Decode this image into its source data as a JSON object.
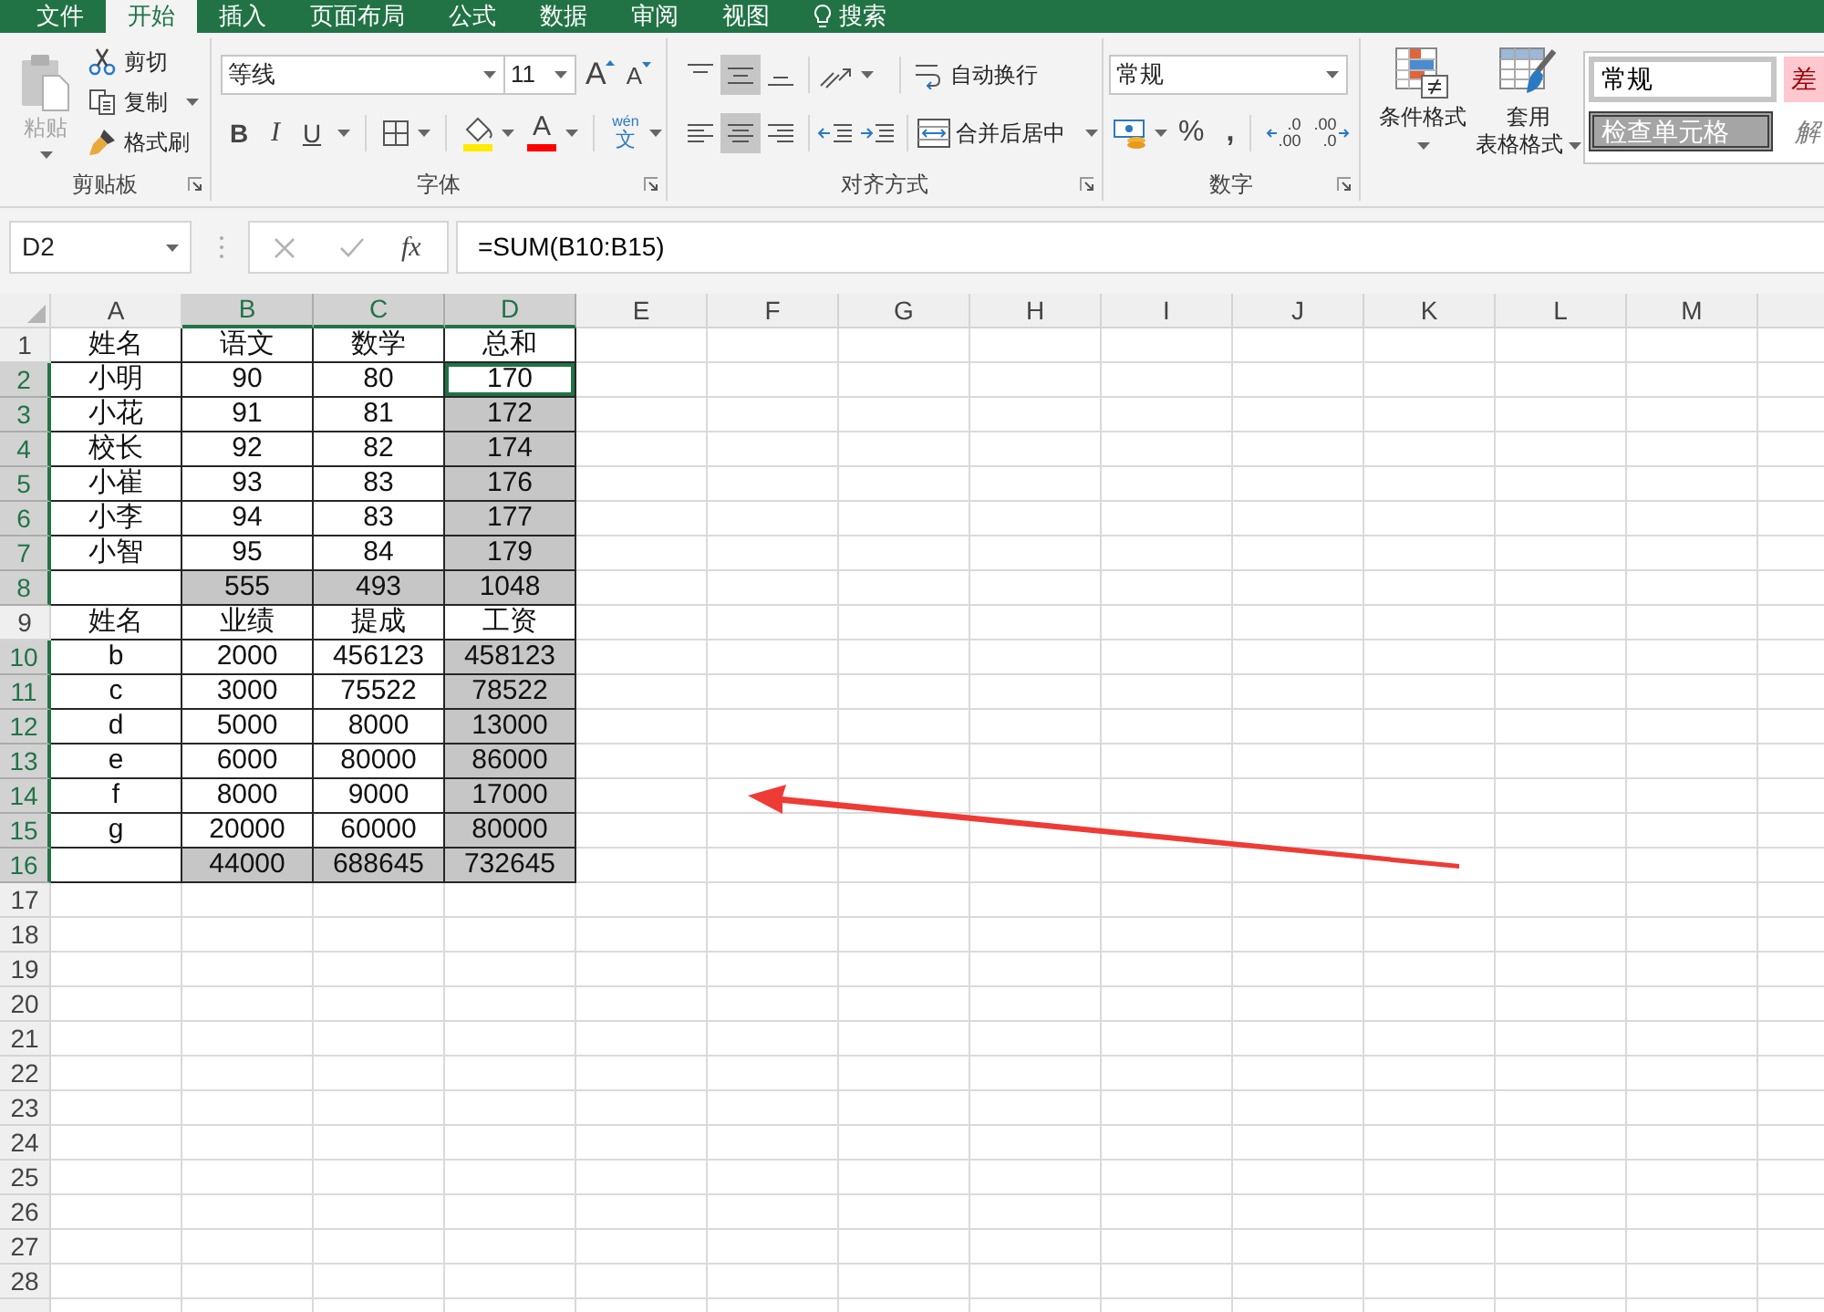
{
  "tabs": [
    {
      "kind": "tab",
      "label": "文件",
      "selected": false
    },
    {
      "kind": "tab",
      "label": "开始",
      "selected": true
    },
    {
      "kind": "tab",
      "label": "插入",
      "selected": false
    },
    {
      "kind": "tab",
      "label": "页面布局",
      "selected": false
    },
    {
      "kind": "tab",
      "label": "公式",
      "selected": false
    },
    {
      "kind": "tab",
      "label": "数据",
      "selected": false
    },
    {
      "kind": "tab",
      "label": "审阅",
      "selected": false
    },
    {
      "kind": "tab",
      "label": "视图",
      "selected": false
    },
    {
      "kind": "search",
      "label": "搜索",
      "selected": false
    }
  ],
  "ribbon": {
    "clipboard": {
      "label": "剪贴板",
      "paste": {
        "label": "粘贴",
        "disabled": true
      },
      "commands": [
        {
          "kind": "cut",
          "label": "剪切",
          "dropdown": false
        },
        {
          "kind": "copy",
          "label": "复制",
          "dropdown": true
        },
        {
          "kind": "brush",
          "label": "格式刷",
          "dropdown": false
        }
      ]
    },
    "font": {
      "label": "字体",
      "family": "等线",
      "size": "11",
      "grow": "A",
      "shrink": "A",
      "bold": "B",
      "italic": "I",
      "underline": "U",
      "font_color": "A",
      "phonetic": {
        "reading": "wén",
        "glyph": "文"
      }
    },
    "alignment": {
      "label": "对齐方式",
      "vertical": [
        {
          "kind": "top",
          "selected": false
        },
        {
          "kind": "middle",
          "selected": true
        },
        {
          "kind": "bottom",
          "selected": false
        }
      ],
      "horizontal": [
        {
          "kind": "left",
          "selected": false
        },
        {
          "kind": "center",
          "selected": true
        },
        {
          "kind": "right",
          "selected": false
        }
      ],
      "wrap_text": "自动换行",
      "merge_center": "合并后居中"
    },
    "number": {
      "label": "数字",
      "format": "常规",
      "percent": "%",
      "comma": ",",
      "increase_decimal": {
        "top": ".0",
        "bottom": ".00"
      },
      "decrease_decimal": {
        "top": ".00",
        "bottom": ".0"
      }
    },
    "styles": {
      "conditional_format": "条件格式",
      "table_format": [
        "套用",
        "表格格式"
      ],
      "cell_styles": [
        {
          "kind": "normal",
          "label": "常规"
        },
        {
          "kind": "bad",
          "label": "差"
        },
        {
          "kind": "check",
          "label": "检查单元格"
        },
        {
          "kind": "explanatory",
          "label": "解"
        }
      ]
    }
  },
  "formula_bar": {
    "name_box": "D2",
    "function_button": "fx",
    "formula": "=SUM(B10:B15)"
  },
  "sheet": {
    "columns": [
      {
        "label": "A",
        "selected": false
      },
      {
        "label": "B",
        "selected": true
      },
      {
        "label": "C",
        "selected": true
      },
      {
        "label": "D",
        "selected": true
      },
      {
        "label": "E",
        "selected": false
      },
      {
        "label": "F",
        "selected": false
      },
      {
        "label": "G",
        "selected": false
      },
      {
        "label": "H",
        "selected": false
      },
      {
        "label": "I",
        "selected": false
      },
      {
        "label": "J",
        "selected": false
      },
      {
        "label": "K",
        "selected": false
      },
      {
        "label": "L",
        "selected": false
      },
      {
        "label": "M",
        "selected": false
      },
      {
        "selected": false
      }
    ],
    "rows": [
      {
        "label": "1",
        "selected": false,
        "cells": [
          {
            "text": "姓名",
            "selected": false,
            "active": false
          },
          {
            "text": "语文",
            "selected": false,
            "active": false
          },
          {
            "text": "数学",
            "selected": false,
            "active": false
          },
          {
            "text": "总和",
            "selected": false,
            "active": false
          }
        ]
      },
      {
        "label": "2",
        "selected": true,
        "cells": [
          {
            "text": "小明",
            "selected": false,
            "active": false
          },
          {
            "text": "90",
            "selected": false,
            "active": false
          },
          {
            "text": "80",
            "selected": false,
            "active": false
          },
          {
            "text": "170",
            "selected": false,
            "active": true
          }
        ]
      },
      {
        "label": "3",
        "selected": true,
        "cells": [
          {
            "text": "小花",
            "selected": false,
            "active": false
          },
          {
            "text": "91",
            "selected": false,
            "active": false
          },
          {
            "text": "81",
            "selected": false,
            "active": false
          },
          {
            "text": "172",
            "selected": true,
            "active": false
          }
        ]
      },
      {
        "label": "4",
        "selected": true,
        "cells": [
          {
            "text": "校长",
            "selected": false,
            "active": false
          },
          {
            "text": "92",
            "selected": false,
            "active": false
          },
          {
            "text": "82",
            "selected": false,
            "active": false
          },
          {
            "text": "174",
            "selected": true,
            "active": false
          }
        ]
      },
      {
        "label": "5",
        "selected": true,
        "cells": [
          {
            "text": "小崔",
            "selected": false,
            "active": false
          },
          {
            "text": "93",
            "selected": false,
            "active": false
          },
          {
            "text": "83",
            "selected": false,
            "active": false
          },
          {
            "text": "176",
            "selected": true,
            "active": false
          }
        ]
      },
      {
        "label": "6",
        "selected": true,
        "cells": [
          {
            "text": "小李",
            "selected": false,
            "active": false
          },
          {
            "text": "94",
            "selected": false,
            "active": false
          },
          {
            "text": "83",
            "selected": false,
            "active": false
          },
          {
            "text": "177",
            "selected": true,
            "active": false
          }
        ]
      },
      {
        "label": "7",
        "selected": true,
        "cells": [
          {
            "text": "小智",
            "selected": false,
            "active": false
          },
          {
            "text": "95",
            "selected": false,
            "active": false
          },
          {
            "text": "84",
            "selected": false,
            "active": false
          },
          {
            "text": "179",
            "selected": true,
            "active": false
          }
        ]
      },
      {
        "label": "8",
        "selected": true,
        "cells": [
          {
            "selected": false,
            "active": false
          },
          {
            "text": "555",
            "selected": true,
            "active": false
          },
          {
            "text": "493",
            "selected": true,
            "active": false
          },
          {
            "text": "1048",
            "selected": true,
            "active": false
          }
        ]
      },
      {
        "label": "9",
        "selected": false,
        "cells": [
          {
            "text": "姓名",
            "selected": false,
            "active": false
          },
          {
            "text": "业绩",
            "selected": false,
            "active": false
          },
          {
            "text": "提成",
            "selected": false,
            "active": false
          },
          {
            "text": "工资",
            "selected": false,
            "active": false
          }
        ]
      },
      {
        "label": "10",
        "selected": true,
        "cells": [
          {
            "text": "b",
            "selected": false,
            "active": false
          },
          {
            "text": "2000",
            "selected": false,
            "active": false
          },
          {
            "text": "456123",
            "selected": false,
            "active": false
          },
          {
            "text": "458123",
            "selected": true,
            "active": false
          }
        ]
      },
      {
        "label": "11",
        "selected": true,
        "cells": [
          {
            "text": "c",
            "selected": false,
            "active": false
          },
          {
            "text": "3000",
            "selected": false,
            "active": false
          },
          {
            "text": "75522",
            "selected": false,
            "active": false
          },
          {
            "text": "78522",
            "selected": true,
            "active": false
          }
        ]
      },
      {
        "label": "12",
        "selected": true,
        "cells": [
          {
            "text": "d",
            "selected": false,
            "active": false
          },
          {
            "text": "5000",
            "selected": false,
            "active": false
          },
          {
            "text": "8000",
            "selected": false,
            "active": false
          },
          {
            "text": "13000",
            "selected": true,
            "active": false
          }
        ]
      },
      {
        "label": "13",
        "selected": true,
        "cells": [
          {
            "text": "e",
            "selected": false,
            "active": false
          },
          {
            "text": "6000",
            "selected": false,
            "active": false
          },
          {
            "text": "80000",
            "selected": false,
            "active": false
          },
          {
            "text": "86000",
            "selected": true,
            "active": false
          }
        ]
      },
      {
        "label": "14",
        "selected": true,
        "cells": [
          {
            "text": "f",
            "selected": false,
            "active": false
          },
          {
            "text": "8000",
            "selected": false,
            "active": false
          },
          {
            "text": "9000",
            "selected": false,
            "active": false
          },
          {
            "text": "17000",
            "selected": true,
            "active": false
          }
        ]
      },
      {
        "label": "15",
        "selected": true,
        "cells": [
          {
            "text": "g",
            "selected": false,
            "active": false
          },
          {
            "text": "20000",
            "selected": false,
            "active": false
          },
          {
            "text": "60000",
            "selected": false,
            "active": false
          },
          {
            "text": "80000",
            "selected": true,
            "active": false
          }
        ]
      },
      {
        "label": "16",
        "selected": true,
        "cells": [
          {
            "selected": false,
            "active": false
          },
          {
            "text": "44000",
            "selected": true,
            "active": false
          },
          {
            "text": "688645",
            "selected": true,
            "active": false
          },
          {
            "text": "732645",
            "selected": true,
            "active": false
          }
        ]
      },
      {
        "label": "17",
        "selected": false
      },
      {
        "label": "18",
        "selected": false
      },
      {
        "label": "19",
        "selected": false
      },
      {
        "label": "20",
        "selected": false
      },
      {
        "label": "21",
        "selected": false
      },
      {
        "label": "22",
        "selected": false
      },
      {
        "label": "23",
        "selected": false
      },
      {
        "label": "24",
        "selected": false
      },
      {
        "label": "25",
        "selected": false
      },
      {
        "label": "26",
        "selected": false
      },
      {
        "label": "27",
        "selected": false
      },
      {
        "label": "28",
        "selected": false
      },
      {
        "selected": false
      }
    ]
  }
}
